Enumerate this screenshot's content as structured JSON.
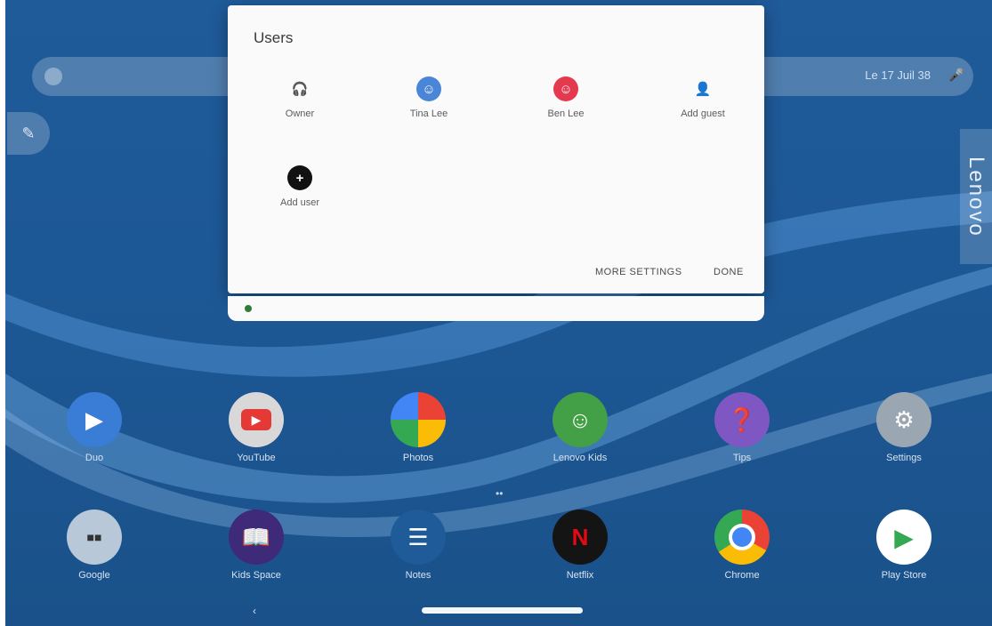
{
  "search": {
    "date_text": "Le 17 Juil 38",
    "mic_icon": "mic-icon",
    "g_icon": "google-icon"
  },
  "edit_icon": "pencil-icon",
  "brand": {
    "text": "Lenovo"
  },
  "dialog": {
    "title": "Users",
    "users": [
      {
        "name": "Owner",
        "icon": "owner-headphone-icon",
        "color": "#3b6fb5"
      },
      {
        "name": "Tina Lee",
        "icon": "user-avatar-icon",
        "color": "#4a86d8"
      },
      {
        "name": "Ben Lee",
        "icon": "user-avatar-icon",
        "color": "#e53950"
      },
      {
        "name": "Add guest",
        "icon": "guest-icon",
        "color": "#9e9e9e"
      },
      {
        "name": "Add user",
        "icon": "add-user-icon",
        "color": "#111111"
      }
    ],
    "more_settings_label": "MORE SETTINGS",
    "done_label": "DONE"
  },
  "apps_row1": [
    {
      "label": "Duo",
      "icon": "duo-video-icon",
      "color": "#3a7dd6"
    },
    {
      "label": "YouTube",
      "icon": "youtube-icon",
      "color": "#e53935"
    },
    {
      "label": "Photos",
      "icon": "photos-icon",
      "color": "#f4b400"
    },
    {
      "label": "Lenovo Kids",
      "icon": "kids-icon",
      "color": "#43a047"
    },
    {
      "label": "Tips",
      "icon": "tips-icon",
      "color": "#7e57c2"
    },
    {
      "label": "Settings",
      "icon": "settings-gear-icon",
      "color": "#607d8b"
    }
  ],
  "apps_row2": [
    {
      "label": "Google",
      "icon": "google-folder-icon",
      "color": "#9fb4c8"
    },
    {
      "label": "Kids Space",
      "icon": "book-icon",
      "color": "#3f2a7a"
    },
    {
      "label": "Notes",
      "icon": "notes-icon",
      "color": "#6d8fb3"
    },
    {
      "label": "Netflix",
      "icon": "netflix-icon",
      "color": "#141414"
    },
    {
      "label": "Chrome",
      "icon": "chrome-icon",
      "color": "#f4b400"
    },
    {
      "label": "Play Store",
      "icon": "play-store-icon",
      "color": "#ffffff"
    }
  ]
}
